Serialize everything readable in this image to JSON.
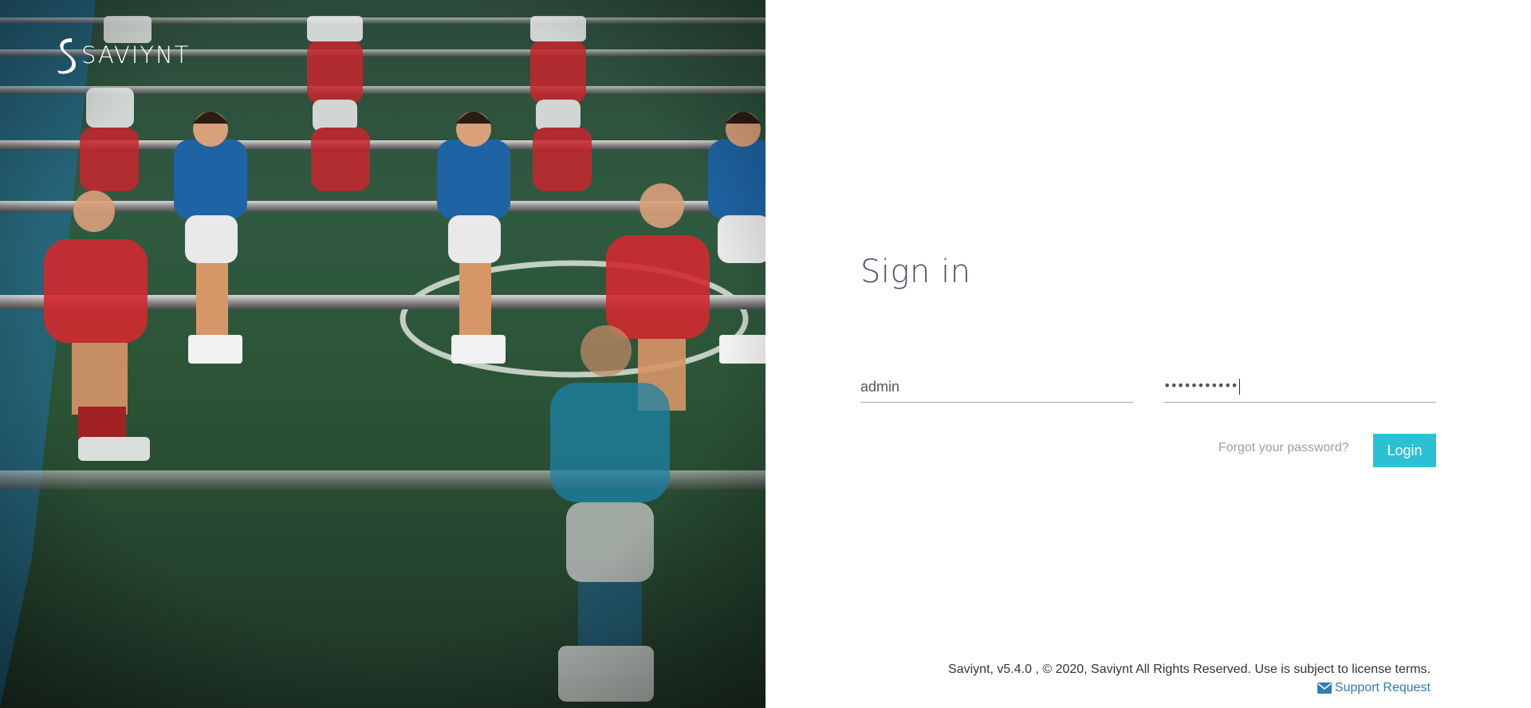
{
  "brand": {
    "name": "SAVIYNT",
    "logo_icon": "saviynt-s-logo-icon",
    "accent_color": "#2bc0d4",
    "link_color": "#337ab7"
  },
  "hero": {
    "image": "foosball-table-photo"
  },
  "signin": {
    "title": "Sign in",
    "username_value": "admin",
    "password_masked": "•••••••••••",
    "forgot_label": "Forgot your password?",
    "login_label": "Login"
  },
  "footer": {
    "copyright": "Saviynt, v5.4.0 , © 2020, Saviynt All Rights Reserved. Use is subject to license terms.",
    "support_label": "Support Request",
    "support_icon": "envelope-icon"
  }
}
